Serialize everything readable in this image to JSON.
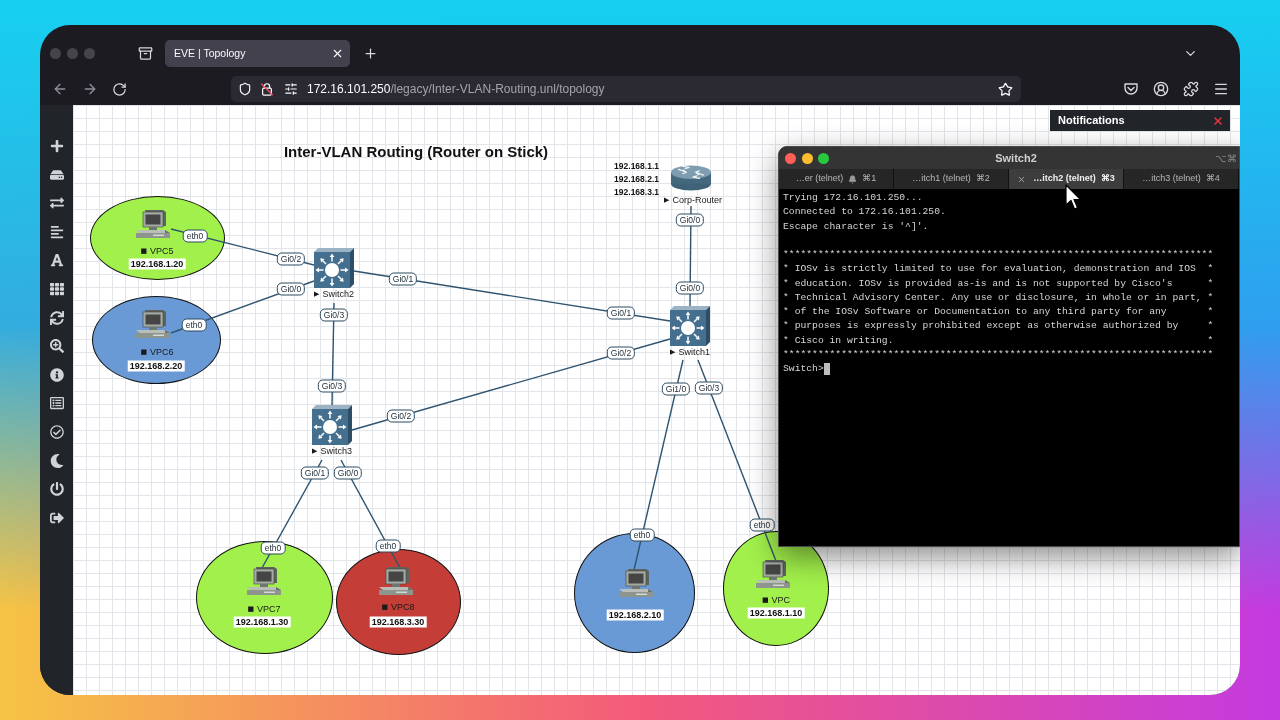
{
  "browser": {
    "tabs": [
      {
        "title": "EVE | Topology",
        "selected": true
      }
    ],
    "address": {
      "host": "172.16.101.250",
      "path": "/legacy/Inter-VLAN-Routing.unl/topology"
    }
  },
  "notifications": {
    "title": "Notifications"
  },
  "topology": {
    "title": "Inter-VLAN Routing (Router on Stick)",
    "nodes": [
      {
        "kind": "vpc",
        "marker": "■",
        "name": "VPC5",
        "ip": "192.168.1.20",
        "color": "#a1f04b"
      },
      {
        "kind": "vpc",
        "marker": "■",
        "name": "VPC6",
        "ip": "192.168.2.20",
        "color": "#699ad6"
      },
      {
        "kind": "switch",
        "marker": "▶",
        "name": "Switch2"
      },
      {
        "kind": "router",
        "marker": "▶",
        "name": "Corp-Router",
        "ips": [
          "192.168.1.1",
          "192.168.2.1",
          "192.168.3.1"
        ]
      },
      {
        "kind": "switch",
        "marker": "▶",
        "name": "Switch1"
      },
      {
        "kind": "switch",
        "marker": "▶",
        "name": "Switch3"
      },
      {
        "kind": "vpc",
        "marker": "■",
        "name": "VPC7",
        "ip": "192.168.1.30",
        "color": "#a1f04b"
      },
      {
        "kind": "vpc",
        "marker": "■",
        "name": "VPC8",
        "ip": "192.168.3.30",
        "color": "#c43d37"
      },
      {
        "kind": "vpc",
        "ip": "192.168.2.10",
        "color": "#699ad6"
      },
      {
        "kind": "vpc",
        "marker": "■",
        "name": "VPC",
        "ip": "192.168.1.10",
        "color": "#a1f04b"
      }
    ],
    "links": [
      {
        "ports": [
          "eth0",
          "Gi0/2"
        ]
      },
      {
        "ports": [
          "eth0",
          "Gi0/0"
        ]
      },
      {
        "ports": [
          "Gi0/1",
          "Gi0/1"
        ]
      },
      {
        "ports": [
          "Gi0/3",
          "Gi0/3"
        ]
      },
      {
        "ports": [
          "Gi0/2",
          "Gi0/2"
        ]
      },
      {
        "ports": [
          "Gi0/0",
          "Gi0/0"
        ]
      },
      {
        "ports": [
          "Gi0/1",
          "eth0"
        ]
      },
      {
        "ports": [
          "Gi0/0",
          "eth0"
        ]
      },
      {
        "ports": [
          "Gi1/0",
          "eth0"
        ]
      },
      {
        "ports": [
          "Gi0/3",
          "eth0"
        ]
      }
    ]
  },
  "terminal": {
    "title": "Switch2",
    "shortcut": "⌥⌘",
    "tabs": [
      {
        "label": "…er (telnet)",
        "shortcut": "⌘1",
        "bell": true,
        "selected": false
      },
      {
        "label": "…itch1 (telnet)",
        "shortcut": "⌘2",
        "bell": false,
        "selected": false
      },
      {
        "label": "…itch2 (telnet)",
        "shortcut": "⌘3",
        "bell": false,
        "selected": true
      },
      {
        "label": "…itch3 (telnet)",
        "shortcut": "⌘4",
        "bell": false,
        "selected": false
      }
    ],
    "blocks": [
      [
        "Trying 172.16.101.250...",
        "Connected to 172.16.101.250.",
        "Escape character is '^]'."
      ],
      [
        "**************************************************************************",
        "* IOSv is strictly limited to use for evaluation, demonstration and IOS  *",
        "* education. IOSv is provided as-is and is not supported by Cisco's      *",
        "* Technical Advisory Center. Any use or disclosure, in whole or in part, *",
        "* of the IOSv Software or Documentation to any third party for any       *",
        "* purposes is expressly prohibited except as otherwise authorized by     *",
        "* Cisco in writing.                                                      *",
        "**************************************************************************"
      ]
    ],
    "prompt": "Switch>",
    "cursor": true
  }
}
